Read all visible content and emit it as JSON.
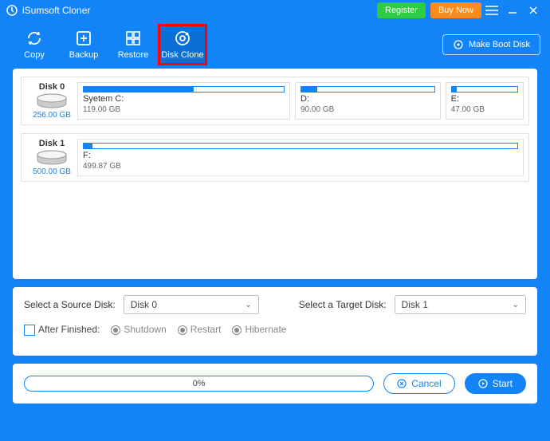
{
  "title": "iSumsoft Cloner",
  "titlebar": {
    "register": "Register",
    "buynow": "Buy Now"
  },
  "toolbar": {
    "copy": "Copy",
    "backup": "Backup",
    "restore": "Restore",
    "diskclone": "Disk Clone",
    "bootdisk": "Make Boot Disk"
  },
  "disks": [
    {
      "name": "Disk 0",
      "size": "256.00 GB",
      "partitions": [
        {
          "label": "Syetem C:",
          "size": "119.00 GB",
          "fill": 55,
          "flex": 3
        },
        {
          "label": "D:",
          "size": "90.00 GB",
          "fill": 12,
          "flex": 2
        },
        {
          "label": "E:",
          "size": "47.00 GB",
          "fill": 8,
          "flex": 1
        }
      ]
    },
    {
      "name": "Disk 1",
      "size": "500.00 GB",
      "partitions": [
        {
          "label": "F:",
          "size": "499.87 GB",
          "fill": 2,
          "flex": 1
        }
      ]
    }
  ],
  "controls": {
    "source_label": "Select a Source Disk:",
    "source_value": "Disk 0",
    "target_label": "Select a Target Disk:",
    "target_value": "Disk 1",
    "after_label": "After Finished:",
    "opts": {
      "shutdown": "Shutdown",
      "restart": "Restart",
      "hibernate": "Hibernate"
    }
  },
  "footer": {
    "progress_text": "0%",
    "cancel": "Cancel",
    "start": "Start"
  }
}
